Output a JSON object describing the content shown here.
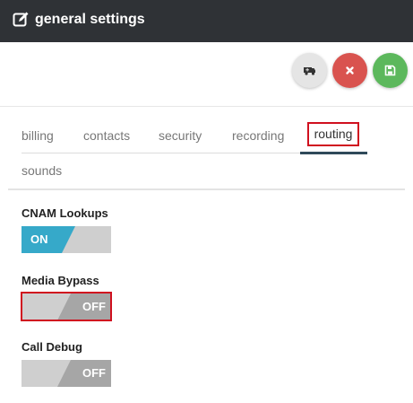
{
  "header": {
    "title": "general settings",
    "icon": "edit-icon"
  },
  "actions": {
    "ambulance": {
      "icon": "ambulance-icon",
      "color": "#e5e5e5"
    },
    "close": {
      "icon": "close-icon",
      "color": "#d9534f"
    },
    "save": {
      "icon": "save-icon",
      "color": "#5cb85c"
    }
  },
  "tabs": [
    {
      "label": "billing"
    },
    {
      "label": "contacts"
    },
    {
      "label": "security"
    },
    {
      "label": "recording"
    },
    {
      "label": "routing",
      "active": true
    },
    {
      "label": "sounds"
    }
  ],
  "settings": [
    {
      "label": "CNAM Lookups",
      "state": "ON",
      "on": true,
      "on_color": "#36a9c9"
    },
    {
      "label": "Media Bypass",
      "state": "OFF",
      "on": false,
      "highlighted": true
    },
    {
      "label": "Call Debug",
      "state": "OFF",
      "on": false
    }
  ],
  "colors": {
    "header_bg": "#2f3236",
    "highlight": "#d0101f",
    "toggle_off": "#a6a6a6",
    "toggle_off_light": "#cfcfcf"
  }
}
